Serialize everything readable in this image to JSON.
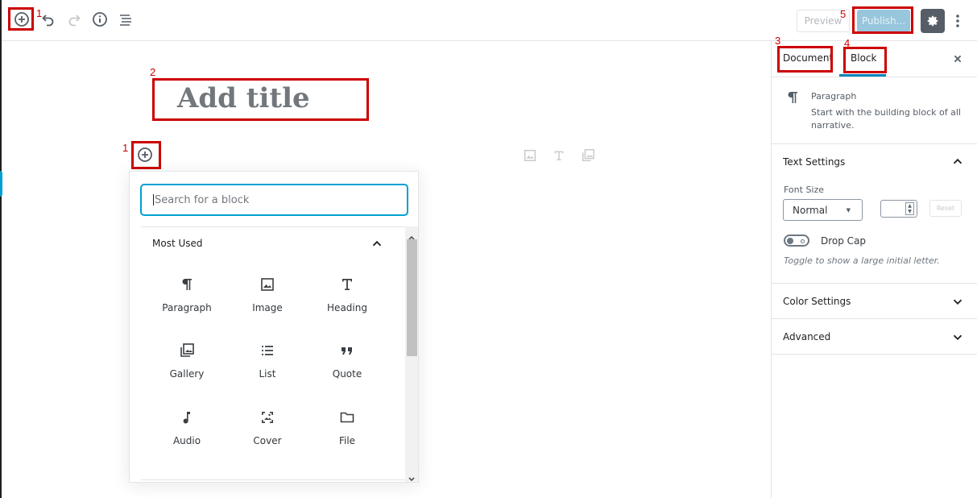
{
  "toolbar": {
    "add_block_tooltip": "Add block",
    "preview_label": "Preview",
    "publish_label": "Publish..."
  },
  "annotations": {
    "n1": "1",
    "n2": "2",
    "n3": "3",
    "n4": "4",
    "n5": "5",
    "color": "#cc0000"
  },
  "editor": {
    "title_placeholder": "Add title"
  },
  "inserter": {
    "search_placeholder": "Search for a block",
    "panel_title": "Most Used",
    "blocks": [
      {
        "label": "Paragraph",
        "icon": "paragraph-icon"
      },
      {
        "label": "Image",
        "icon": "image-icon"
      },
      {
        "label": "Heading",
        "icon": "heading-icon"
      },
      {
        "label": "Gallery",
        "icon": "gallery-icon"
      },
      {
        "label": "List",
        "icon": "list-icon"
      },
      {
        "label": "Quote",
        "icon": "quote-icon"
      },
      {
        "label": "Audio",
        "icon": "audio-icon"
      },
      {
        "label": "Cover",
        "icon": "cover-icon"
      },
      {
        "label": "File",
        "icon": "file-icon"
      }
    ]
  },
  "sidebar": {
    "tab_document": "Document",
    "tab_block": "Block",
    "block_card": {
      "title": "Paragraph",
      "description": "Start with the building block of all narrative."
    },
    "text_settings": {
      "title": "Text Settings",
      "font_size_label": "Font Size",
      "font_size_value": "Normal",
      "reset_label": "Reset",
      "drop_cap_label": "Drop Cap",
      "drop_cap_help": "Toggle to show a large initial letter."
    },
    "color_settings_title": "Color Settings",
    "advanced_title": "Advanced"
  },
  "colors": {
    "accent": "#0085ba",
    "publish_bg": "#98c6dc",
    "settings_bg": "#555d66"
  }
}
